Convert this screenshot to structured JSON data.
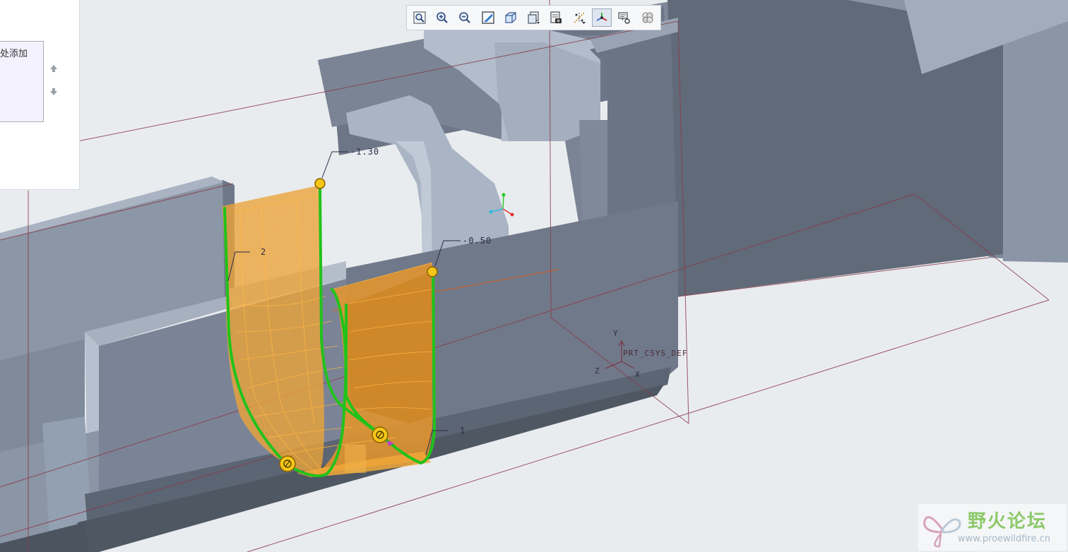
{
  "panel": {
    "list_text": "处添加",
    "move_up_icon": "arrow-up-icon",
    "move_down_icon": "arrow-down-icon"
  },
  "toolbar": {
    "buttons": [
      {
        "icon": "zoom-window-icon",
        "active": false
      },
      {
        "icon": "zoom-in-icon",
        "active": false
      },
      {
        "icon": "zoom-out-icon",
        "active": false
      },
      {
        "icon": "repaint-icon",
        "active": false
      },
      {
        "icon": "display-style-icon",
        "active": false
      },
      {
        "icon": "saved-views-icon",
        "active": false
      },
      {
        "icon": "view-manager-icon",
        "active": false
      },
      {
        "icon": "datum-display-icon",
        "active": false
      },
      {
        "icon": "spin-center-icon",
        "active": true
      },
      {
        "icon": "annotation-display-icon",
        "active": false
      },
      {
        "icon": "appearance-gallery-icon",
        "active": false
      }
    ]
  },
  "annotations": {
    "dim_top": "-1.30",
    "dim_right": "-0.50",
    "dim_left": "2",
    "dim_bottom": "1"
  },
  "csys": {
    "name": "PRT_CSYS_DEF",
    "axis_y": "Y",
    "axis_z": "Z",
    "axis_x": "X"
  },
  "watermark": {
    "title": "野火论坛",
    "url": "www.proewildfire.cn"
  },
  "colors": {
    "background": "#e9ecef",
    "model_face": "#8893a3",
    "model_dark": "#5f6774",
    "model_light": "#a9b3c2",
    "surface_fill": "#f0a73a",
    "curve": "#22c21b",
    "datum": "#8b3a4a",
    "point": "#f5c518"
  }
}
